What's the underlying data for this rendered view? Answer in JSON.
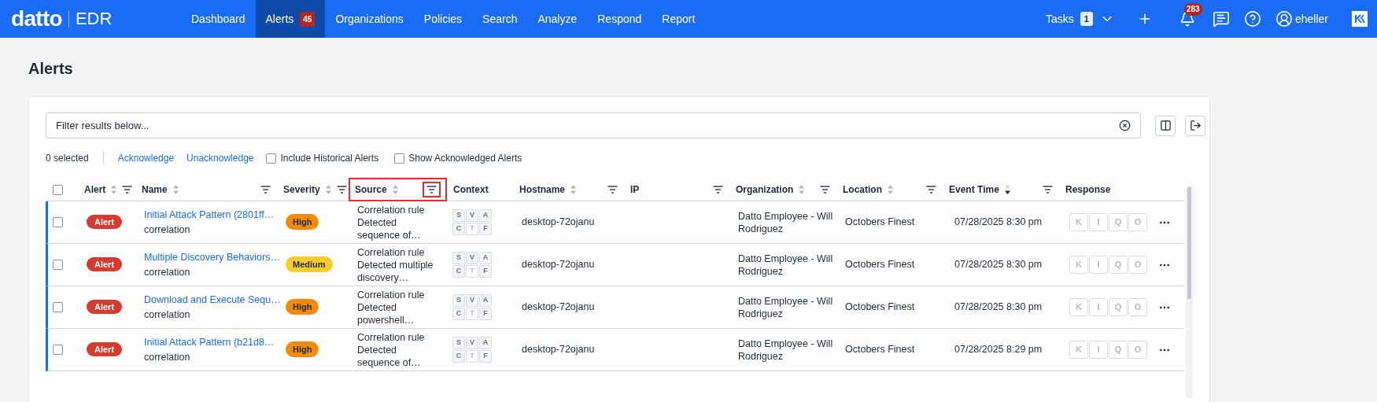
{
  "nav": {
    "logo": "datto",
    "product": "EDR",
    "items": [
      {
        "label": "Dashboard",
        "selected": false
      },
      {
        "label": "Alerts",
        "selected": true,
        "badge": "45"
      },
      {
        "label": "Organizations",
        "selected": false
      },
      {
        "label": "Policies",
        "selected": false
      },
      {
        "label": "Search",
        "selected": false
      },
      {
        "label": "Analyze",
        "selected": false
      },
      {
        "label": "Respond",
        "selected": false
      },
      {
        "label": "Report",
        "selected": false
      }
    ],
    "tasks": {
      "label": "Tasks",
      "count": "1"
    },
    "notifications": "283",
    "user": "eheller"
  },
  "page_title": "Alerts",
  "filter": {
    "placeholder": "Filter results below..."
  },
  "toolbar": {
    "selected_count": "0 selected",
    "actions": [
      "Acknowledge",
      "Unacknowledge"
    ],
    "options": [
      {
        "label": "Include Historical Alerts",
        "checked": false
      },
      {
        "label": "Show Acknowledged Alerts",
        "checked": false
      }
    ]
  },
  "table": {
    "select_all_checked": false,
    "columns": [
      {
        "label": "Alert",
        "sorted_descending": false,
        "filter": true,
        "highlighted": false
      },
      {
        "label": "Name",
        "sorted_descending": false,
        "filter": true,
        "highlighted": false
      },
      {
        "label": "Severity",
        "sorted_descending": false,
        "filter": true,
        "highlighted": false
      },
      {
        "label": "Source",
        "sorted_descending": false,
        "filter": true,
        "highlighted": true
      },
      {
        "label": "Context",
        "highlighted": false
      },
      {
        "label": "Hostname",
        "sorted_descending": false,
        "filter": true,
        "highlighted": false
      },
      {
        "label": "IP",
        "filter": true,
        "highlighted": false
      },
      {
        "label": "Organization",
        "sorted_descending": false,
        "filter": true,
        "highlighted": false
      },
      {
        "label": "Location",
        "sorted_descending": false,
        "filter": true,
        "highlighted": false
      },
      {
        "label": "Event Time",
        "sorted_descending": true,
        "filter": true,
        "highlighted": false
      },
      {
        "label": "Response",
        "highlighted": false
      }
    ],
    "rows": [
      {
        "checked": false,
        "status": "Alert",
        "name": "Initial Attack Pattern (2801ff…",
        "type": "correlation",
        "severity": {
          "label": "High",
          "kind": "high"
        },
        "source": [
          "Correlation rule",
          "Detected",
          "sequence of…"
        ],
        "context": [
          {
            "letter": "S",
            "disabled": false
          },
          {
            "letter": "V",
            "disabled": false
          },
          {
            "letter": "A",
            "disabled": false
          },
          {
            "letter": "C",
            "disabled": false
          },
          {
            "letter": "T",
            "disabled": true
          },
          {
            "letter": "F",
            "disabled": false
          }
        ],
        "hostname": "desktop-72ojanu",
        "organization": "Datto Employee - Will Rodriguez",
        "location": "Octobers Finest",
        "event_time": "07/28/2025 8:30 pm",
        "response": [
          "K",
          "I",
          "Q",
          "O"
        ]
      },
      {
        "checked": false,
        "status": "Alert",
        "name": "Multiple Discovery Behaviors…",
        "type": "correlation",
        "severity": {
          "label": "Medium",
          "kind": "medium"
        },
        "source": [
          "Correlation rule",
          "Detected multiple",
          "discovery…"
        ],
        "context": [
          {
            "letter": "S",
            "disabled": false
          },
          {
            "letter": "V",
            "disabled": false
          },
          {
            "letter": "A",
            "disabled": false
          },
          {
            "letter": "C",
            "disabled": false
          },
          {
            "letter": "T",
            "disabled": true
          },
          {
            "letter": "F",
            "disabled": false
          }
        ],
        "hostname": "desktop-72ojanu",
        "organization": "Datto Employee - Will Rodriguez",
        "location": "Octobers Finest",
        "event_time": "07/28/2025 8:30 pm",
        "response": [
          "K",
          "I",
          "Q",
          "O"
        ]
      },
      {
        "checked": false,
        "status": "Alert",
        "name": "Download and Execute Sequ…",
        "type": "correlation",
        "severity": {
          "label": "High",
          "kind": "high"
        },
        "source": [
          "Correlation rule",
          "Detected",
          "powershell…"
        ],
        "context": [
          {
            "letter": "S",
            "disabled": false
          },
          {
            "letter": "V",
            "disabled": false
          },
          {
            "letter": "A",
            "disabled": false
          },
          {
            "letter": "C",
            "disabled": false
          },
          {
            "letter": "T",
            "disabled": true
          },
          {
            "letter": "F",
            "disabled": false
          }
        ],
        "hostname": "desktop-72ojanu",
        "organization": "Datto Employee - Will Rodriguez",
        "location": "Octobers Finest",
        "event_time": "07/28/2025 8:30 pm",
        "response": [
          "K",
          "I",
          "Q",
          "O"
        ]
      },
      {
        "checked": false,
        "status": "Alert",
        "name": "Initial Attack Pattern (b21d8…",
        "type": "correlation",
        "severity": {
          "label": "High",
          "kind": "high"
        },
        "source": [
          "Correlation rule",
          "Detected",
          "sequence of…"
        ],
        "context": [
          {
            "letter": "S",
            "disabled": false
          },
          {
            "letter": "V",
            "disabled": false
          },
          {
            "letter": "A",
            "disabled": false
          },
          {
            "letter": "C",
            "disabled": false
          },
          {
            "letter": "T",
            "disabled": true
          },
          {
            "letter": "F",
            "disabled": false
          }
        ],
        "hostname": "desktop-72ojanu",
        "organization": "Datto Employee - Will Rodriguez",
        "location": "Octobers Finest",
        "event_time": "07/28/2025 8:29 pm",
        "response": [
          "K",
          "I",
          "Q",
          "O"
        ]
      }
    ]
  }
}
